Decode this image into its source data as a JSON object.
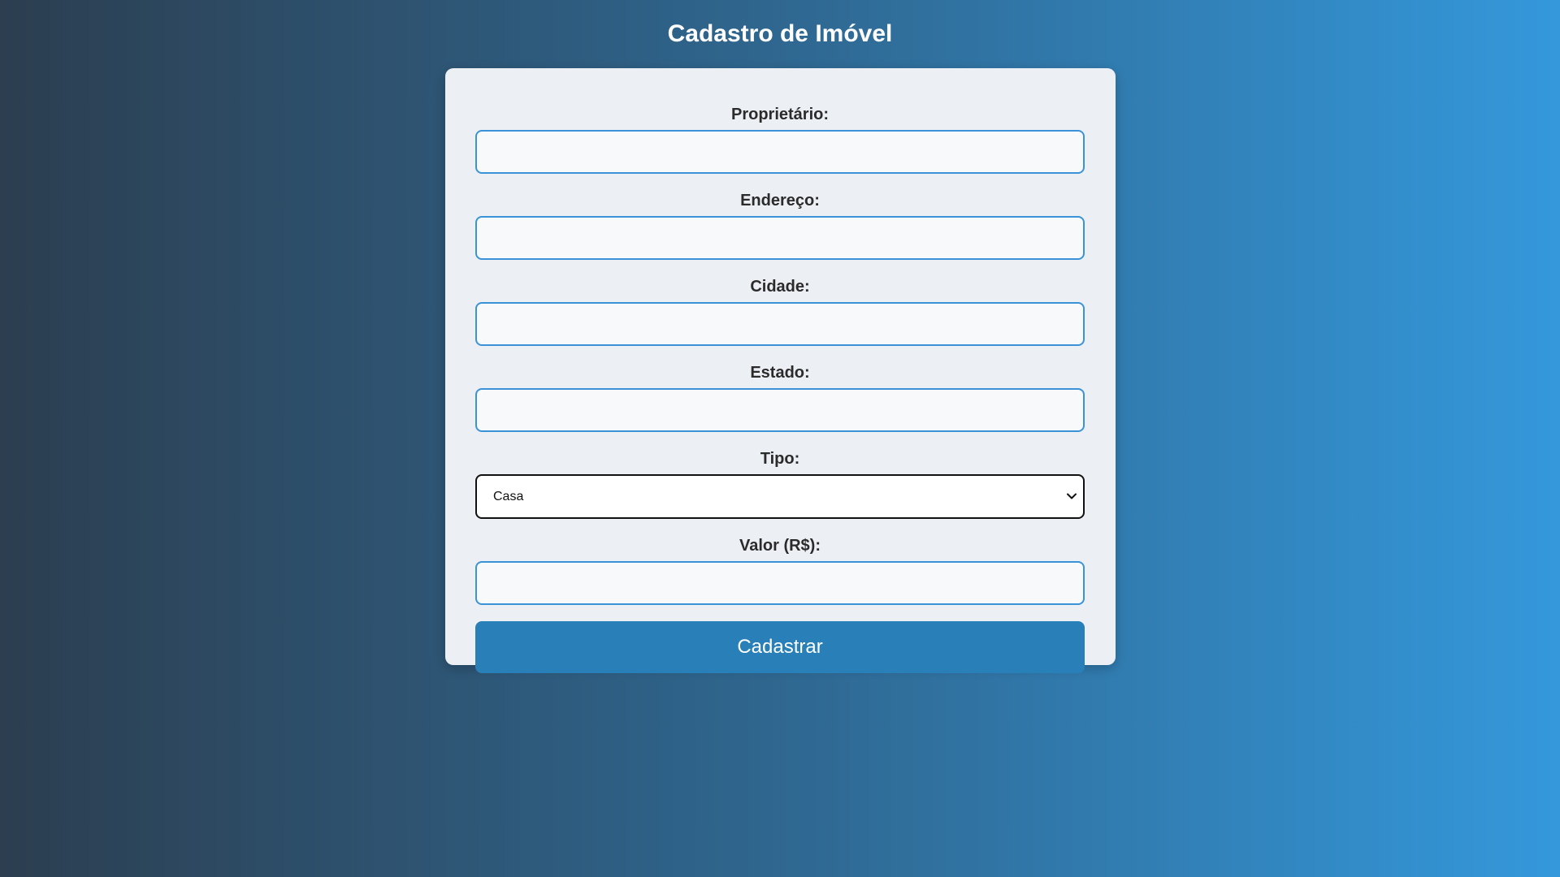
{
  "page": {
    "title": "Cadastro de Imóvel"
  },
  "form": {
    "fields": [
      {
        "label": "Proprietário:",
        "value": "",
        "placeholder": ""
      },
      {
        "label": "Endereço:",
        "value": "",
        "placeholder": ""
      },
      {
        "label": "Cidade:",
        "value": "",
        "placeholder": ""
      },
      {
        "label": "Estado:",
        "value": "",
        "placeholder": ""
      }
    ],
    "tipo": {
      "label": "Tipo:",
      "selected": "Casa"
    },
    "valor": {
      "label": "Valor (R$):",
      "value": "",
      "placeholder": ""
    },
    "submit_label": "Cadastrar"
  },
  "colors": {
    "background_start": "#2c3e50",
    "background_end": "#3498db",
    "card": "#ecf0f5",
    "input_border": "#3a93d6",
    "button": "#2980b9"
  },
  "icons": {
    "select_arrow": "chevron-down-icon"
  }
}
